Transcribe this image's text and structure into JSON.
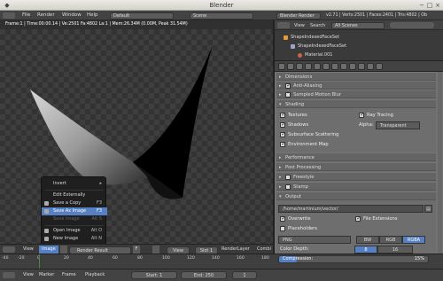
{
  "window": {
    "title": "Blender"
  },
  "topbar": {
    "menus": [
      "File",
      "Render",
      "Window",
      "Help"
    ],
    "layout": "Default",
    "scene": "Scene",
    "engine": "Blender Render",
    "stats": "v2.71 | Verts:2501 | Faces:2401 | Tris:4802 | Ob"
  },
  "viewport": {
    "info": "Frame:1 | Time:00:00.14 | Ve:2501 Fa:4802 La:1 | Mem:26.34M (0.00M, Peak 31.54M)"
  },
  "image_menu": {
    "items": [
      {
        "label": "Invert",
        "shortcut": "▸",
        "disabled": false,
        "highlighted": false
      },
      {
        "label": "Edit Externally",
        "shortcut": "",
        "disabled": false,
        "highlighted": false
      },
      {
        "label": "Save a Copy",
        "shortcut": "F3",
        "disabled": false,
        "highlighted": false
      },
      {
        "label": "Save As Image",
        "shortcut": "F3",
        "disabled": false,
        "highlighted": true
      },
      {
        "label": "Save Image",
        "shortcut": "Alt S",
        "disabled": true,
        "highlighted": false
      },
      {
        "label": "Open Image",
        "shortcut": "Alt O",
        "disabled": false,
        "highlighted": false
      },
      {
        "label": "New Image",
        "shortcut": "Alt N",
        "disabled": false,
        "highlighted": false
      }
    ]
  },
  "image_header": {
    "view": "View",
    "image": "Image",
    "render_result": "Render Result",
    "f_label": "F",
    "view2": "View",
    "slot": "Slot 1",
    "render_layer": "RenderLayer",
    "combined": "Combi"
  },
  "timeline": {
    "ticks": [
      "-40",
      "-20",
      "0",
      "20",
      "40",
      "60",
      "80",
      "100",
      "120",
      "140",
      "160",
      "180",
      "200",
      "220",
      "240",
      "260"
    ]
  },
  "bottombar": {
    "items": [
      "View",
      "Marker",
      "Frame",
      "Playback"
    ],
    "start_label": "Start:",
    "start_value": "1",
    "end_label": "End:",
    "end_value": "250",
    "current": "1"
  },
  "right_header": {
    "view": "View",
    "search": "Search",
    "all_scenes": "All Scenes"
  },
  "outliner": {
    "rows": [
      "ShapeIndexedFaceSet",
      "ShapeIndexedFaceSet",
      "Material.001"
    ]
  },
  "props": {
    "ss_label": "ShapeIndexedFaceSet",
    "dimensions": "Dimensions",
    "anti_aliasing": "Anti-Aliasing",
    "sampled_motion_blur": "Sampled Motion Blur",
    "shading": "Shading",
    "textures": "Textures",
    "ray_tracing": "Ray Tracing",
    "shadows": "Shadows",
    "alpha_label": "Alpha:",
    "alpha_value": "Transparent",
    "subsurface": "Subsurface Scattering",
    "env_map": "Environment Map",
    "performance": "Performance",
    "post_processing": "Post Processing",
    "freestyle": "Freestyle",
    "stamp": "Stamp",
    "output": "Output",
    "path": "/home/martinium/vector/",
    "overwrite": "Overwrite",
    "file_extensions": "File Extensions",
    "placeholders": "Placeholders",
    "format": "PNG",
    "bw": "BW",
    "rgb": "RGB",
    "rgba": "RGBA",
    "color_depth_label": "Color Depth:",
    "depth_8": "8",
    "depth_16": "16",
    "compression_label": "Compression:",
    "compression_value": "15%",
    "bake": "Bake"
  },
  "colors": {
    "accent": "#5680c2",
    "bg": "#3e3e3e",
    "panel": "#6e6e6e"
  }
}
